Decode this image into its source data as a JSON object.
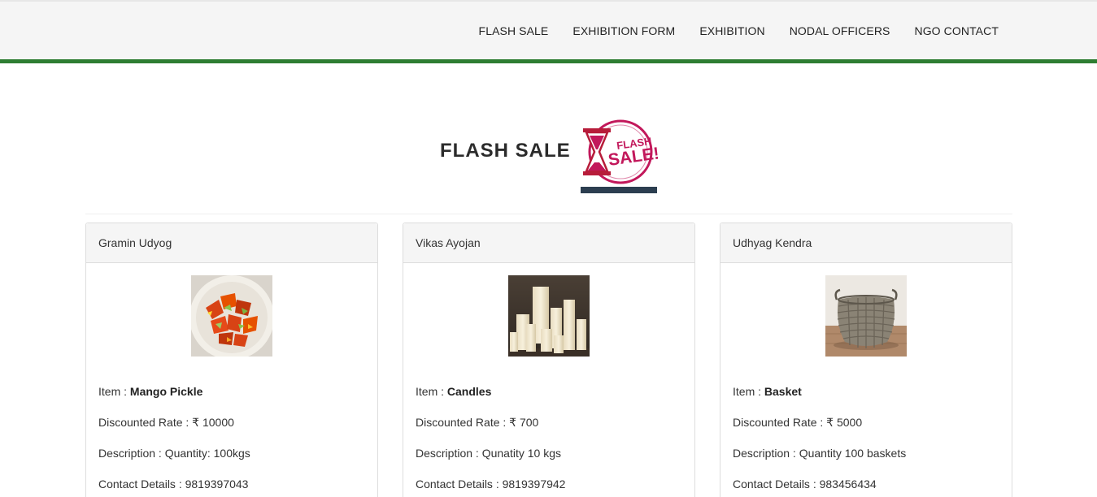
{
  "nav": {
    "items": [
      {
        "label": "FLASH SALE"
      },
      {
        "label": "EXHIBITION FORM"
      },
      {
        "label": "EXHIBITION"
      },
      {
        "label": "NODAL OFFICERS"
      },
      {
        "label": "NGO CONTACT"
      }
    ]
  },
  "page": {
    "title": "FLASH SALE",
    "logo": {
      "text_line1": "FLASH",
      "text_line2": "SALE!",
      "icon": "hourglass-icon"
    }
  },
  "colors": {
    "accent_green": "#2e7d32",
    "logo_red": "#c2185b"
  },
  "labels": {
    "item": "Item : ",
    "rate": "Discounted Rate : ",
    "description": "Description : ",
    "contact": "Contact Details : "
  },
  "products": [
    {
      "seller": "Gramin Udyog",
      "item": "Mango Pickle",
      "rate": "₹ 10000",
      "description": "Quantity: 100kgs",
      "contact": "9819397043",
      "image": "mango-pickle-photo"
    },
    {
      "seller": "Vikas Ayojan",
      "item": "Candles",
      "rate": "₹ 700",
      "description": "Qunatity 10 kgs",
      "contact": "9819397942",
      "image": "candles-photo"
    },
    {
      "seller": "Udhyag Kendra",
      "item": "Basket",
      "rate": "₹ 5000",
      "description": "Quantity 100 baskets",
      "contact": "983456434",
      "image": "basket-photo"
    }
  ]
}
